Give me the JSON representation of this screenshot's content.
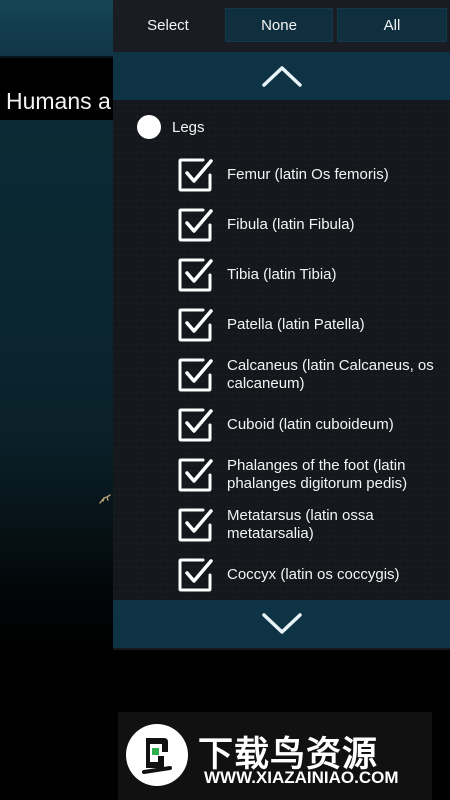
{
  "background": {
    "title": "Humans a"
  },
  "selector": {
    "label": "Select",
    "none_label": "None",
    "all_label": "All"
  },
  "group": {
    "label": "Legs",
    "selected": true
  },
  "items": [
    {
      "label": "Femur (latin Os femoris)",
      "checked": true
    },
    {
      "label": "Fibula (latin Fibula)",
      "checked": true
    },
    {
      "label": "Tibia (latin Tibia)",
      "checked": true
    },
    {
      "label": "Patella (latin Patella)",
      "checked": true
    },
    {
      "label": "Calcaneus (latin Calcaneus, os calcaneum)",
      "checked": true
    },
    {
      "label": "Cuboid (latin cuboideum)",
      "checked": true
    },
    {
      "label": "Phalanges of the foot (latin phalanges digitorum pedis)",
      "checked": true
    },
    {
      "label": "Metatarsus (latin ossa metatarsalia)",
      "checked": true
    },
    {
      "label": "Coccyx (latin os coccygis)",
      "checked": true
    }
  ],
  "icons": {
    "scroll_up": "chevron-up-icon",
    "scroll_down": "chevron-down-icon",
    "checkbox": "checkbox-checked-icon",
    "radio": "radio-selected-icon",
    "logo": "bird-logo-icon"
  },
  "watermark": {
    "title": "下载鸟资源",
    "url": "WWW.XIAZAINIAO.COM"
  },
  "colors": {
    "panel_bg": "#14171c",
    "button_bg": "#0f2f3f",
    "scroll_bg": "#0e3344",
    "text": "#f4f4f4",
    "logo_green": "#2fae4e"
  }
}
